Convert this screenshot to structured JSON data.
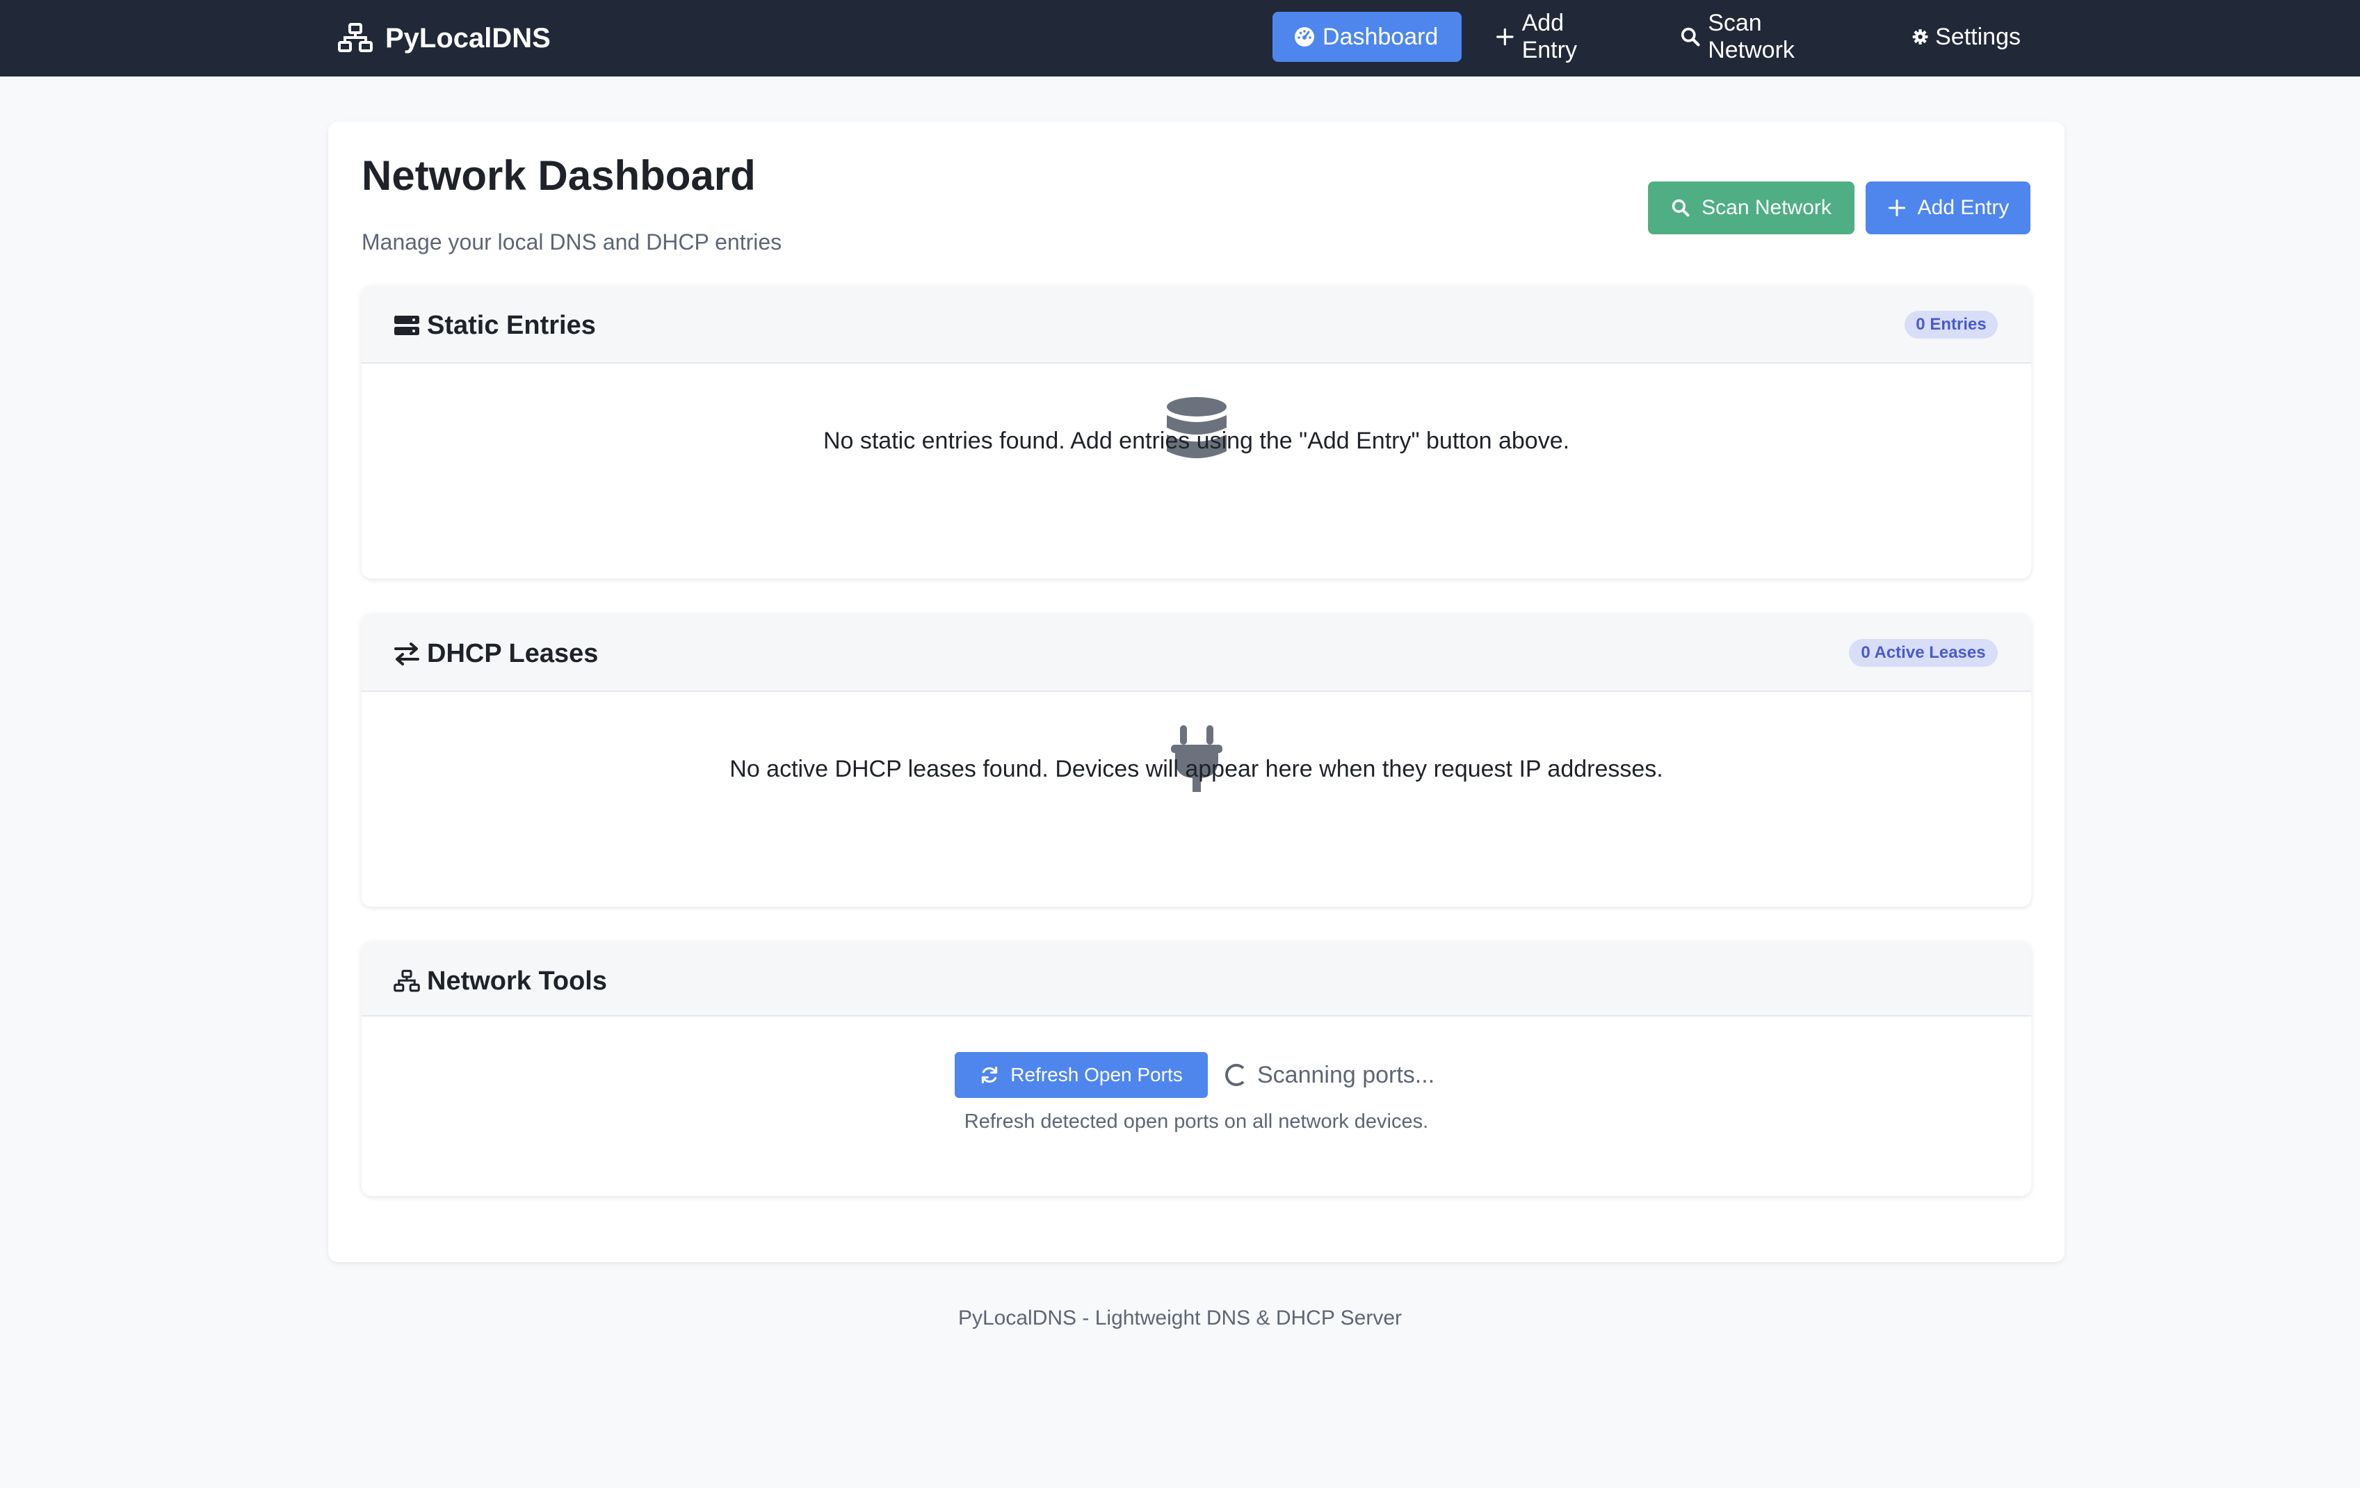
{
  "nav": {
    "brand": "PyLocalDNS",
    "items": [
      {
        "label": "Dashboard",
        "icon": "dashboard-icon",
        "active": true
      },
      {
        "label": "Add Entry",
        "icon": "plus-icon"
      },
      {
        "label": "Scan Network",
        "icon": "search-icon"
      },
      {
        "label": "Settings",
        "icon": "gear-icon"
      }
    ]
  },
  "header": {
    "title": "Network Dashboard",
    "subtitle": "Manage your local DNS and DHCP entries",
    "scan_button": "Scan Network",
    "add_button": "Add Entry"
  },
  "static_entries": {
    "title": "Static Entries",
    "badge": "0 Entries",
    "icon": "server-icon",
    "empty_icon": "database-icon",
    "empty_text": "No static entries found. Add entries using the \"Add Entry\" button above."
  },
  "dhcp_leases": {
    "title": "DHCP Leases",
    "badge": "0 Active Leases",
    "icon": "exchange-icon",
    "empty_icon": "plug-icon",
    "empty_text": "No active DHCP leases found. Devices will appear here when they request IP addresses."
  },
  "network_tools": {
    "title": "Network Tools",
    "icon": "network-icon",
    "refresh_button": "Refresh Open Ports",
    "status": "Scanning ports...",
    "help_text": "Refresh detected open ports on all network devices."
  },
  "footer": {
    "text": "PyLocalDNS - Lightweight DNS & DHCP Server"
  },
  "colors": {
    "navbar_bg": "#212938",
    "primary": "#4e86ee",
    "success": "#4fae84",
    "badge_bg": "#d8def8",
    "badge_text": "#4a5bc9"
  }
}
